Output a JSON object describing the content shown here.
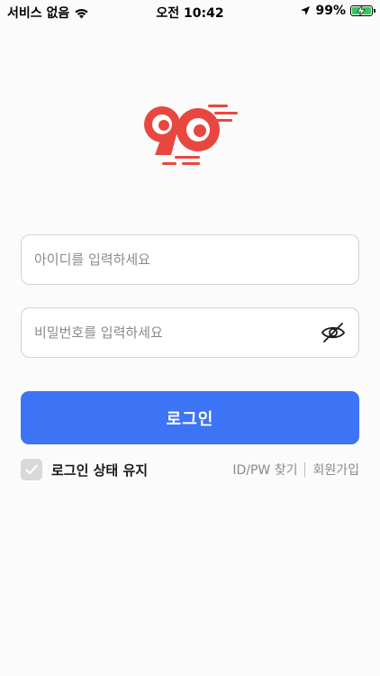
{
  "status_bar": {
    "carrier": "서비스 없음",
    "time": "오전 10:42",
    "battery_percent": "99%"
  },
  "logo": {
    "alt_text": "90",
    "brand_color": "#e8473f"
  },
  "login": {
    "id_placeholder": "아이디를 입력하세요",
    "pw_placeholder": "비밀번호를 입력하세요",
    "id_value": "",
    "pw_value": "",
    "password_visibility_icon": "eye-off-icon",
    "submit_label": "로그인",
    "button_color": "#3d73f5"
  },
  "options": {
    "keep_logged_in_label": "로그인 상태 유지",
    "keep_logged_in_checked": false,
    "find_id_pw_label": "ID/PW 찾기",
    "signup_label": "회원가입"
  }
}
